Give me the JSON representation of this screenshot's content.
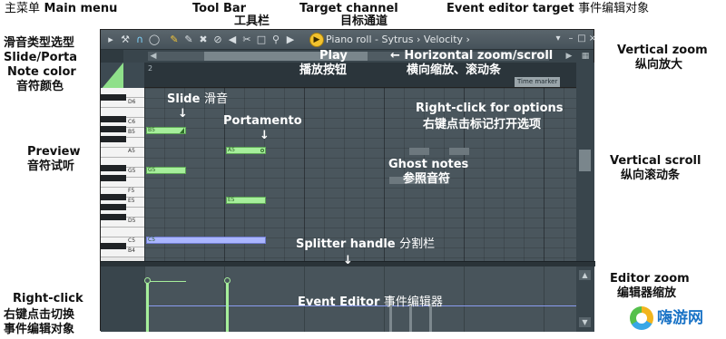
{
  "annotations": {
    "main_menu": {
      "cn": "主菜单",
      "en": "Main menu"
    },
    "tool_bar": {
      "en": "Tool Bar",
      "cn": "工具栏"
    },
    "target_channel": {
      "en": "Target channel",
      "cn": "目标通道"
    },
    "event_editor_target": {
      "en": "Event editor target",
      "cn": "事件编辑对象"
    },
    "slide_porta": {
      "cn": "滑音类型选型",
      "en": "Slide/Porta"
    },
    "note_color": {
      "en": "Note color",
      "cn": "音符颜色"
    },
    "play": {
      "en": "Play",
      "cn": "播放按钮"
    },
    "horizontal_zoom": {
      "en": "Horizontal zoom/scroll",
      "cn": "横向缩放、滚动条"
    },
    "vertical_zoom": {
      "en": "Vertical zoom",
      "cn": "纵向放大"
    },
    "slide": {
      "en": "Slide",
      "cn": "滑音"
    },
    "portamento": {
      "en": "Portamento"
    },
    "right_click_options": {
      "en": "Right-click for options",
      "cn": "右键点击标记打开选项"
    },
    "preview": {
      "en": "Preview",
      "cn": "音符试听"
    },
    "ghost_notes": {
      "en": "Ghost notes",
      "cn": "参照音符"
    },
    "vertical_scroll": {
      "en": "Vertical scroll",
      "cn": "纵向滚动条"
    },
    "splitter": {
      "en": "Splitter handle",
      "cn": "分割栏"
    },
    "editor_zoom": {
      "en": "Editor zoom",
      "cn": "编辑器缩放"
    },
    "event_editor": {
      "en": "Event Editor",
      "cn": "事件编辑器"
    },
    "right_click_switch": {
      "en": "Right-click",
      "cn_line1": "右键点击切换",
      "cn_line2": "事件编辑对象"
    }
  },
  "window": {
    "title": "Piano roll - Sytrus › Velocity ›",
    "time_marker": "Time marker",
    "ruler_start": "2"
  },
  "keyboard": {
    "labels": [
      "D6",
      "C6",
      "B5",
      "A5",
      "G5",
      "F5",
      "E5",
      "D5",
      "C5",
      "B4"
    ]
  },
  "notes": {
    "slide_note": "B5",
    "porta_note": "A5",
    "g5_note": "G5",
    "e5_note": "E5",
    "c5_note": "C5"
  },
  "watermark": {
    "text": "嗨游网"
  },
  "colors": {
    "note_green": "#a6ef9b",
    "note_blue": "#aab6ff",
    "window_bg": "#3d4a52",
    "watermark_blue": "#1a73c6"
  },
  "icons": {
    "toolbar": [
      "menu-arrow-icon",
      "wrench-icon",
      "magnet-icon",
      "play-circle-icon",
      "pencil-icon",
      "paint-icon",
      "delete-icon",
      "mute-icon",
      "slice-icon",
      "select-icon",
      "zoom-icon",
      "playback-icon"
    ]
  }
}
